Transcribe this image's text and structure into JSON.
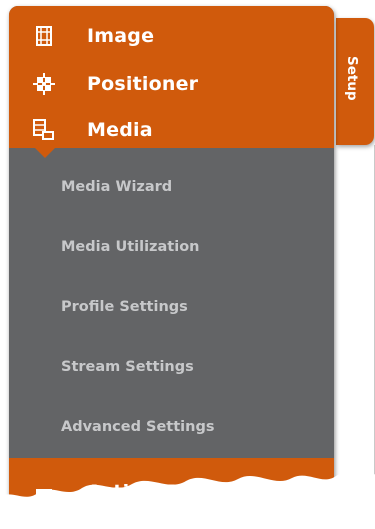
{
  "colors": {
    "accent": "#d05a0c",
    "panel_gray": "#636466",
    "submenu_text": "#c7c8ca",
    "header_text": "#ffffff"
  },
  "menu": {
    "items": [
      {
        "label": "Image",
        "icon": "film-icon"
      },
      {
        "label": "Positioner",
        "icon": "crosshair-icon"
      },
      {
        "label": "Media",
        "icon": "media-icon"
      }
    ],
    "submenu": [
      {
        "label": "Media Wizard"
      },
      {
        "label": "Media Utilization"
      },
      {
        "label": "Profile Settings"
      },
      {
        "label": "Stream Settings"
      },
      {
        "label": "Advanced Settings"
      }
    ],
    "next_item": {
      "label": "Action Engine",
      "icon": "action-icon"
    }
  },
  "side_tab": {
    "label": "Setup"
  }
}
